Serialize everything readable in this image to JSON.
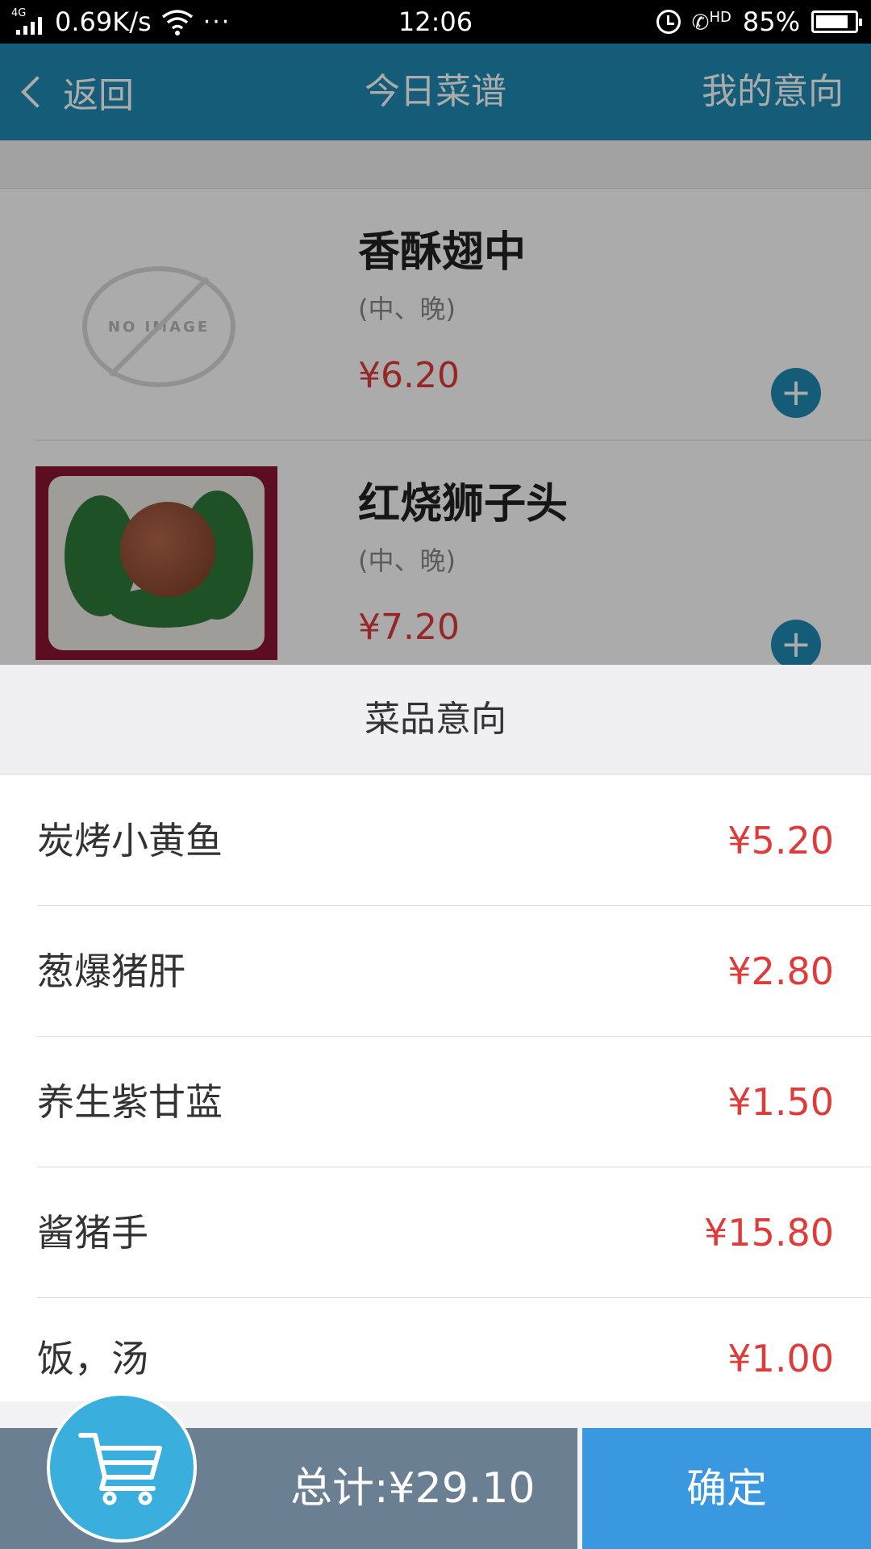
{
  "status_bar": {
    "network": "4G",
    "speed": "0.69K/s",
    "dots": "···",
    "time": "12:06",
    "hd": "HD",
    "battery": "85%"
  },
  "header": {
    "back_label": "返回",
    "title": "今日菜谱",
    "right_label": "我的意向"
  },
  "menu": {
    "no_image_text": "NO IMAGE",
    "dishes": [
      {
        "name": "香酥翅中",
        "meal": "(中、晚)",
        "price": "¥6.20",
        "image": "no-image-placeholder"
      },
      {
        "name": "红烧狮子头",
        "meal": "(中、晚)",
        "price": "¥7.20",
        "image": "meatball-photo"
      }
    ]
  },
  "sheet": {
    "title": "菜品意向",
    "items": [
      {
        "name": "炭烤小黄鱼",
        "price": "¥5.20"
      },
      {
        "name": "葱爆猪肝",
        "price": "¥2.80"
      },
      {
        "name": "养生紫甘蓝",
        "price": "¥1.50"
      },
      {
        "name": "酱猪手",
        "price": "¥15.80"
      },
      {
        "name": "饭，汤",
        "price": "¥1.00"
      }
    ]
  },
  "bottom_bar": {
    "total": "总计:¥29.10",
    "confirm_label": "确定",
    "cart_icon": "shopping-cart-icon"
  },
  "colors": {
    "header_bg": "#1e8ab3",
    "price": "#e03b3b",
    "confirm_bg": "#3a98e0",
    "total_bg": "#6b7f93",
    "cart_bg": "#3aaedd"
  }
}
